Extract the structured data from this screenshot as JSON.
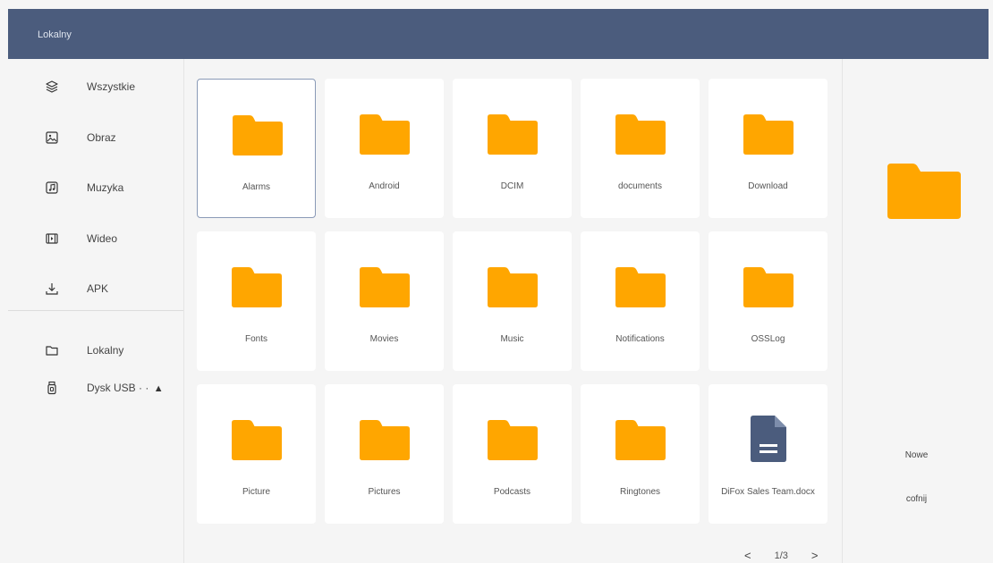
{
  "header": {
    "title": "Lokalny"
  },
  "sidebar": {
    "categories": [
      {
        "label": "Wszystkie",
        "icon": "layers-icon"
      },
      {
        "label": "Obraz",
        "icon": "image-icon"
      },
      {
        "label": "Muzyka",
        "icon": "music-icon"
      },
      {
        "label": "Wideo",
        "icon": "video-icon"
      },
      {
        "label": "APK",
        "icon": "download-icon"
      }
    ],
    "storage": [
      {
        "label": "Lokalny",
        "icon": "folder-icon"
      },
      {
        "label": "Dysk USB · ·",
        "icon": "usb-icon",
        "eject": "▲"
      }
    ]
  },
  "files": [
    {
      "name": "Alarms",
      "type": "folder",
      "selected": true
    },
    {
      "name": "Android",
      "type": "folder"
    },
    {
      "name": "DCIM",
      "type": "folder"
    },
    {
      "name": "documents",
      "type": "folder"
    },
    {
      "name": "Download",
      "type": "folder"
    },
    {
      "name": "Fonts",
      "type": "folder"
    },
    {
      "name": "Movies",
      "type": "folder"
    },
    {
      "name": "Music",
      "type": "folder"
    },
    {
      "name": "Notifications",
      "type": "folder"
    },
    {
      "name": "OSSLog",
      "type": "folder"
    },
    {
      "name": "Picture",
      "type": "folder"
    },
    {
      "name": "Pictures",
      "type": "folder"
    },
    {
      "name": "Podcasts",
      "type": "folder"
    },
    {
      "name": "Ringtones",
      "type": "folder"
    },
    {
      "name": "DiFox Sales Team.docx",
      "type": "document"
    }
  ],
  "pagination": {
    "prev": "<",
    "label": "1/3",
    "next": ">"
  },
  "right_panel": {
    "new_label": "Nowe",
    "back_label": "cofnij"
  },
  "colors": {
    "header_bg": "#4b5c7d",
    "folder": "#ffa600",
    "document": "#4b5c7d",
    "tile_bg": "#ffffff",
    "page_bg": "#f5f5f5"
  }
}
